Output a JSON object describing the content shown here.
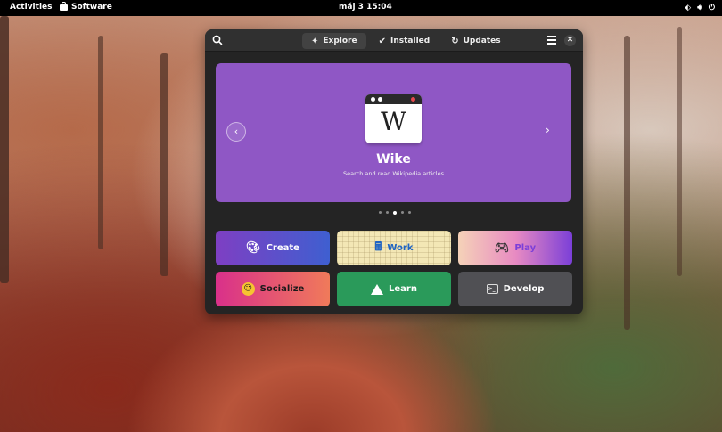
{
  "topbar": {
    "activities": "Activities",
    "app_name": "Software",
    "clock": "máj 3  15:04",
    "tray": {
      "network_icon": "network-icon",
      "volume_icon": "volume-icon",
      "power_icon": "power-icon"
    }
  },
  "window": {
    "tabs": [
      {
        "label": "Explore",
        "icon": "sparkle-icon",
        "active": true
      },
      {
        "label": "Installed",
        "icon": "check-circle-icon",
        "active": false
      },
      {
        "label": "Updates",
        "icon": "refresh-icon",
        "active": false
      }
    ],
    "featured": {
      "app_name": "Wike",
      "description": "Search and read Wikipedia articles",
      "icon_letter": "W",
      "background": "#8f57c5",
      "carousel_pages": 5,
      "carousel_current": 3
    },
    "categories": [
      {
        "label": "Create"
      },
      {
        "label": "Work"
      },
      {
        "label": "Play"
      },
      {
        "label": "Socialize"
      },
      {
        "label": "Learn"
      },
      {
        "label": "Develop"
      }
    ]
  }
}
